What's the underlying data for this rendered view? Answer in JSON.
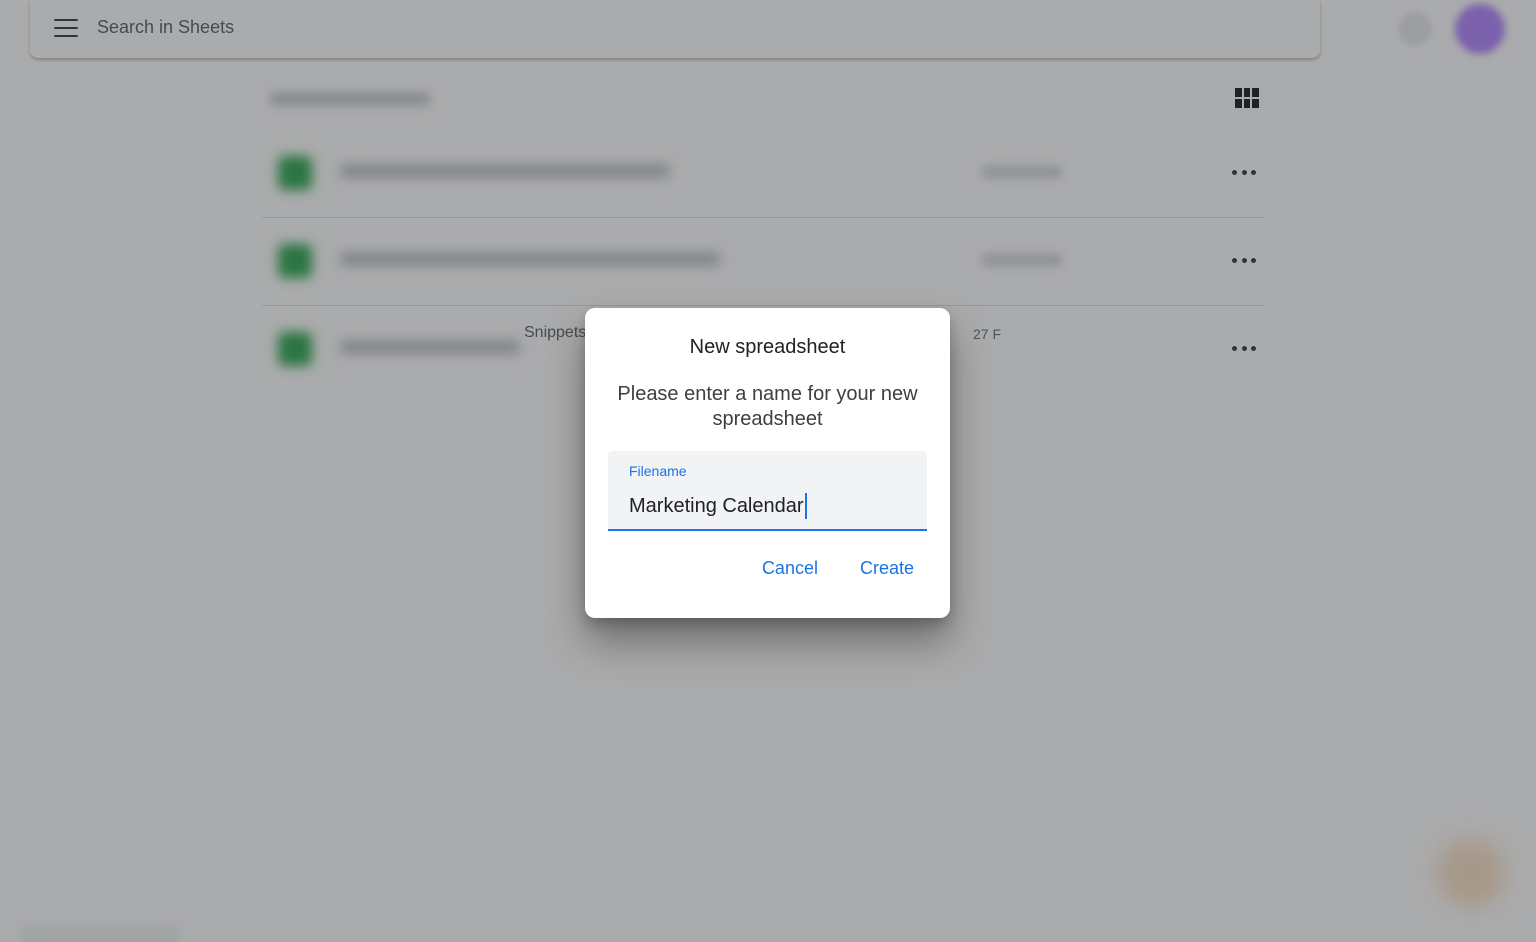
{
  "topbar": {
    "search_placeholder": "Search in Sheets",
    "menu_icon": "hamburger-menu-icon",
    "account_icon": "avatar"
  },
  "view_toggle_icon": "grid-view-icon",
  "file_list": {
    "rows": [
      {
        "visible_name": "",
        "visible_date": ""
      },
      {
        "visible_name": "",
        "visible_date": ""
      },
      {
        "visible_name": "Snippets",
        "visible_date": "27 F"
      }
    ],
    "more_icon": "more-horizontal-icon"
  },
  "dialog": {
    "title": "New spreadsheet",
    "message": "Please enter a name for your new spreadsheet",
    "field_label": "Filename",
    "field_value": "Marketing Calendar",
    "cancel_label": "Cancel",
    "create_label": "Create"
  },
  "colors": {
    "accent": "#1a73e8",
    "scrim": "rgba(32,33,36,0.38)",
    "sheets_green": "#34a853"
  }
}
